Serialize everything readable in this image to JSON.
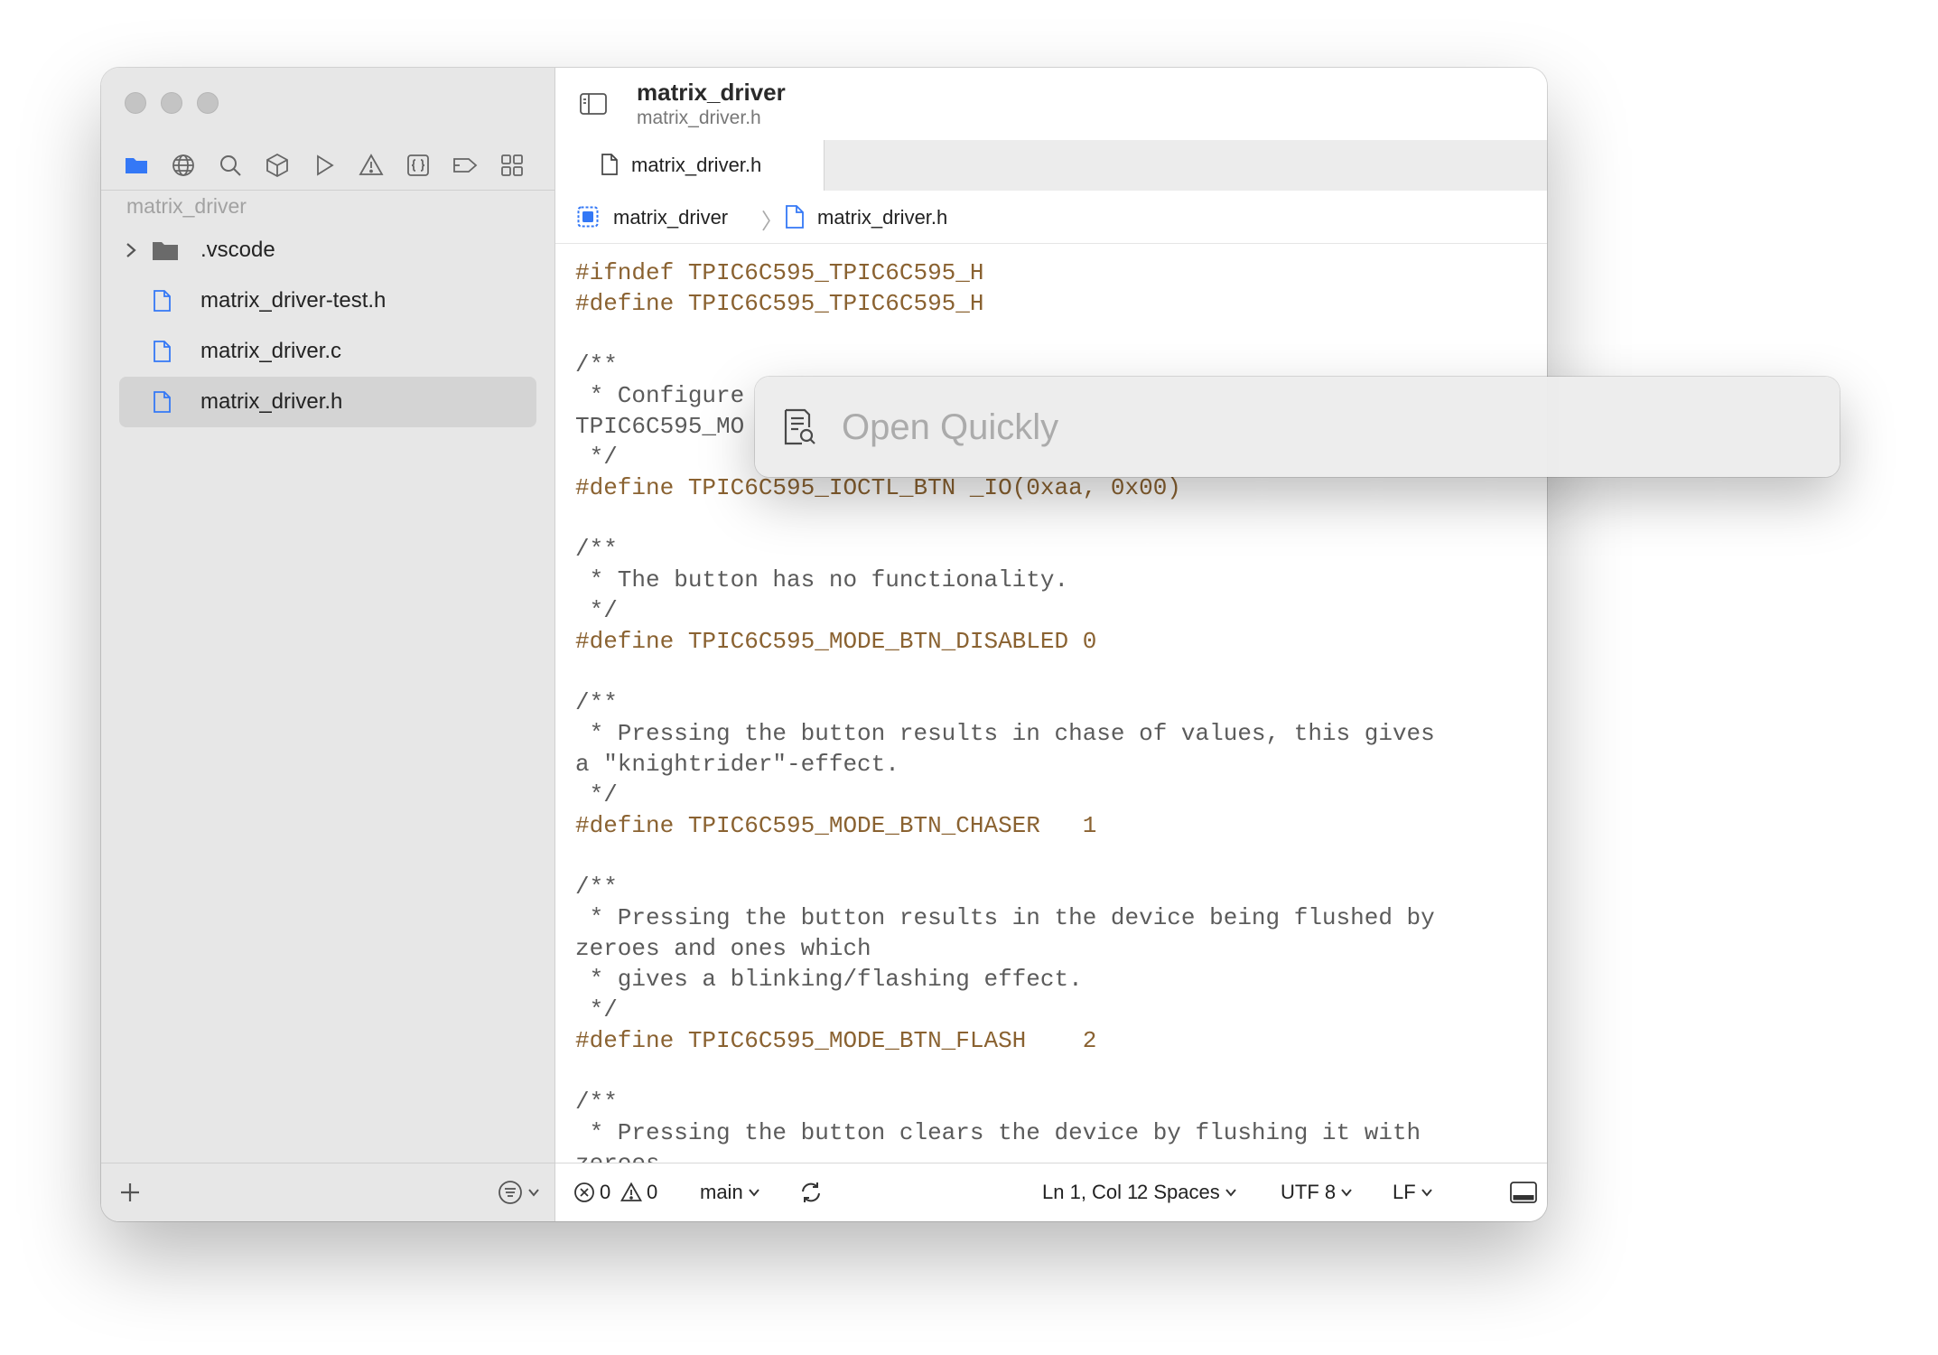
{
  "window": {
    "title": "matrix_driver",
    "subtitle": "matrix_driver.h"
  },
  "sidebar": {
    "nav_icons": [
      "folder-icon",
      "globe-icon",
      "search-icon",
      "package-icon",
      "play-icon",
      "warning-icon",
      "braces-icon",
      "tag-icon",
      "grid-icon"
    ],
    "project_label": "matrix_driver",
    "tree": [
      {
        "name": ".vscode",
        "type": "folder",
        "expanded": false
      },
      {
        "name": "matrix_driver-test.h",
        "type": "file"
      },
      {
        "name": "matrix_driver.c",
        "type": "file"
      },
      {
        "name": "matrix_driver.h",
        "type": "file",
        "selected": true
      }
    ]
  },
  "tabs": [
    {
      "label": "matrix_driver.h",
      "active": true
    }
  ],
  "breadcrumb": {
    "project": "matrix_driver",
    "file": "matrix_driver.h"
  },
  "code_lines": [
    {
      "t": "#ifndef TPIC6C595_TPIC6C595_H",
      "k": "pp"
    },
    {
      "t": "#define TPIC6C595_TPIC6C595_H",
      "k": "pp"
    },
    {
      "t": "",
      "k": "cm"
    },
    {
      "t": "/**",
      "k": "cm"
    },
    {
      "t": " * Configure",
      "k": "cm"
    },
    {
      "t": "TPIC6C595_MO",
      "k": "cm"
    },
    {
      "t": " */",
      "k": "cm"
    },
    {
      "t": "#define TPIC6C595_IOCTL_BTN _IO(0xaa, 0x00)",
      "k": "pp"
    },
    {
      "t": "",
      "k": "cm"
    },
    {
      "t": "/**",
      "k": "cm"
    },
    {
      "t": " * The button has no functionality.",
      "k": "cm"
    },
    {
      "t": " */",
      "k": "cm"
    },
    {
      "t": "#define TPIC6C595_MODE_BTN_DISABLED 0",
      "k": "pp"
    },
    {
      "t": "",
      "k": "cm"
    },
    {
      "t": "/**",
      "k": "cm"
    },
    {
      "t": " * Pressing the button results in chase of values, this gives",
      "k": "cm"
    },
    {
      "t": "a \"knightrider\"-effect.",
      "k": "cm"
    },
    {
      "t": " */",
      "k": "cm"
    },
    {
      "t": "#define TPIC6C595_MODE_BTN_CHASER   1",
      "k": "pp"
    },
    {
      "t": "",
      "k": "cm"
    },
    {
      "t": "/**",
      "k": "cm"
    },
    {
      "t": " * Pressing the button results in the device being flushed by",
      "k": "cm"
    },
    {
      "t": "zeroes and ones which",
      "k": "cm"
    },
    {
      "t": " * gives a blinking/flashing effect.",
      "k": "cm"
    },
    {
      "t": " */",
      "k": "cm"
    },
    {
      "t": "#define TPIC6C595_MODE_BTN_FLASH    2",
      "k": "pp"
    },
    {
      "t": "",
      "k": "cm"
    },
    {
      "t": "/**",
      "k": "cm"
    },
    {
      "t": " * Pressing the button clears the device by flushing it with",
      "k": "cm"
    },
    {
      "t": "zeroes.",
      "k": "cm"
    }
  ],
  "statusbar": {
    "errors": "0",
    "warnings": "0",
    "branch": "main",
    "cursor": "Ln 1, Col 1",
    "indent": "2 Spaces",
    "encoding": "UTF 8",
    "line_ending": "LF"
  },
  "open_quickly": {
    "placeholder": "Open Quickly",
    "value": ""
  },
  "colors": {
    "preprocessor": "#8a6231",
    "comment": "#5b5b5b",
    "accent": "#3478f6"
  }
}
